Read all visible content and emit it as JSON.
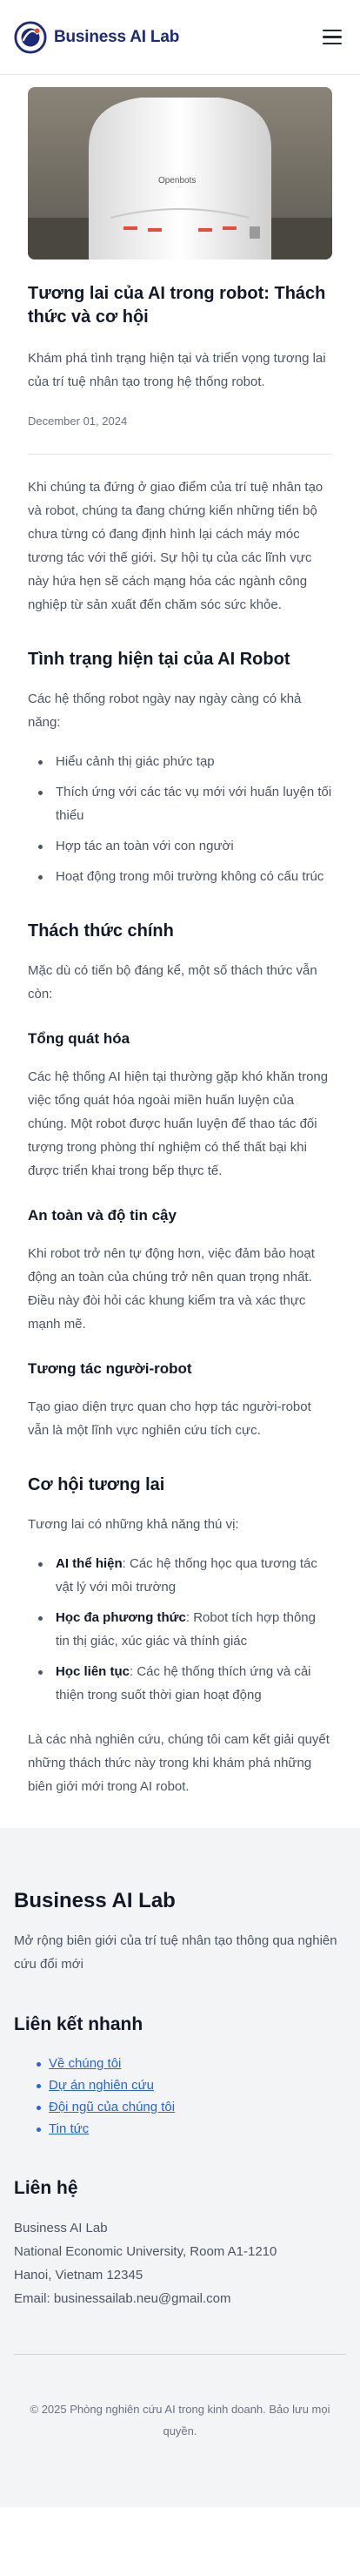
{
  "header": {
    "brand": "Business AI Lab",
    "menu_icon": "hamburger-menu-icon"
  },
  "article": {
    "hero_image": {
      "alt": "",
      "robot_text": "Openbots"
    },
    "title": "Tương lai của AI trong robot: Thách thức và cơ hội",
    "summary": "Khám phá tình trạng hiện tại và triển vọng tương lai của trí tuệ nhân tạo trong hệ thống robot.",
    "date": "December 01, 2024",
    "intro": "Khi chúng ta đứng ở giao điểm của trí tuệ nhân tạo và robot, chúng ta đang chứng kiến những tiến bộ chưa từng có đang định hình lại cách máy móc tương tác với thế giới. Sự hội tụ của các lĩnh vực này hứa hẹn sẽ cách mạng hóa các ngành công nghiệp từ sản xuất đến chăm sóc sức khỏe.",
    "current_state": {
      "heading": "Tình trạng hiện tại của AI Robot",
      "lead": "Các hệ thống robot ngày nay ngày càng có khả năng:",
      "items": [
        "Hiểu cảnh thị giác phức tạp",
        "Thích ứng với các tác vụ mới với huấn luyện tối thiểu",
        "Hợp tác an toàn với con người",
        "Hoạt động trong môi trường không có cấu trúc"
      ]
    },
    "challenges": {
      "heading": "Thách thức chính",
      "lead": "Mặc dù có tiến bộ đáng kể, một số thách thức vẫn còn:",
      "sections": [
        {
          "heading": "Tổng quát hóa",
          "text": "Các hệ thống AI hiện tại thường gặp khó khăn trong việc tổng quát hóa ngoài miền huấn luyện của chúng. Một robot được huấn luyện để thao tác đối tượng trong phòng thí nghiệm có thể thất bại khi được triển khai trong bếp thực tế."
        },
        {
          "heading": "An toàn và độ tin cậy",
          "text": "Khi robot trở nên tự động hơn, việc đảm bảo hoạt động an toàn của chúng trở nên quan trọng nhất. Điều này đòi hỏi các khung kiểm tra và xác thực mạnh mẽ."
        },
        {
          "heading": "Tương tác người-robot",
          "text": "Tạo giao diện trực quan cho hợp tác người-robot vẫn là một lĩnh vực nghiên cứu tích cực."
        }
      ]
    },
    "opportunities": {
      "heading": "Cơ hội tương lai",
      "lead": "Tương lai có những khả năng thú vị:",
      "items": [
        {
          "term": "AI thể hiện",
          "desc": ": Các hệ thống học qua tương tác vật lý với môi trường"
        },
        {
          "term": "Học đa phương thức",
          "desc": ": Robot tích hợp thông tin thị giác, xúc giác và thính giác"
        },
        {
          "term": "Học liên tục",
          "desc": ": Các hệ thống thích ứng và cải thiện trong suốt thời gian hoạt động"
        }
      ],
      "closing": "Là các nhà nghiên cứu, chúng tôi cam kết giải quyết những thách thức này trong khi khám phá những biên giới mới trong AI robot."
    }
  },
  "footer": {
    "title": "Business AI Lab",
    "desc": "Mở rộng biên giới của trí tuệ nhân tạo thông qua nghiên cứu đổi mới",
    "links_heading": "Liên kết nhanh",
    "links": [
      "Về chúng tôi",
      "Dự án nghiên cứu",
      "Đội ngũ của chúng tôi",
      "Tin tức"
    ],
    "contact_heading": "Liên hệ",
    "contact": {
      "name": "Business AI Lab",
      "address1": "National Economic University, Room A1-1210",
      "address2": "Hanoi, Vietnam 12345",
      "email": "Email: businessailab.neu@gmail.com"
    },
    "copyright": "© 2025 Phòng nghiên cứu AI trong kinh doanh. Bảo lưu mọi quyền."
  },
  "colors": {
    "brand": "#1e2a78",
    "link": "#2563eb",
    "footer_bg": "#f3f4f6"
  }
}
